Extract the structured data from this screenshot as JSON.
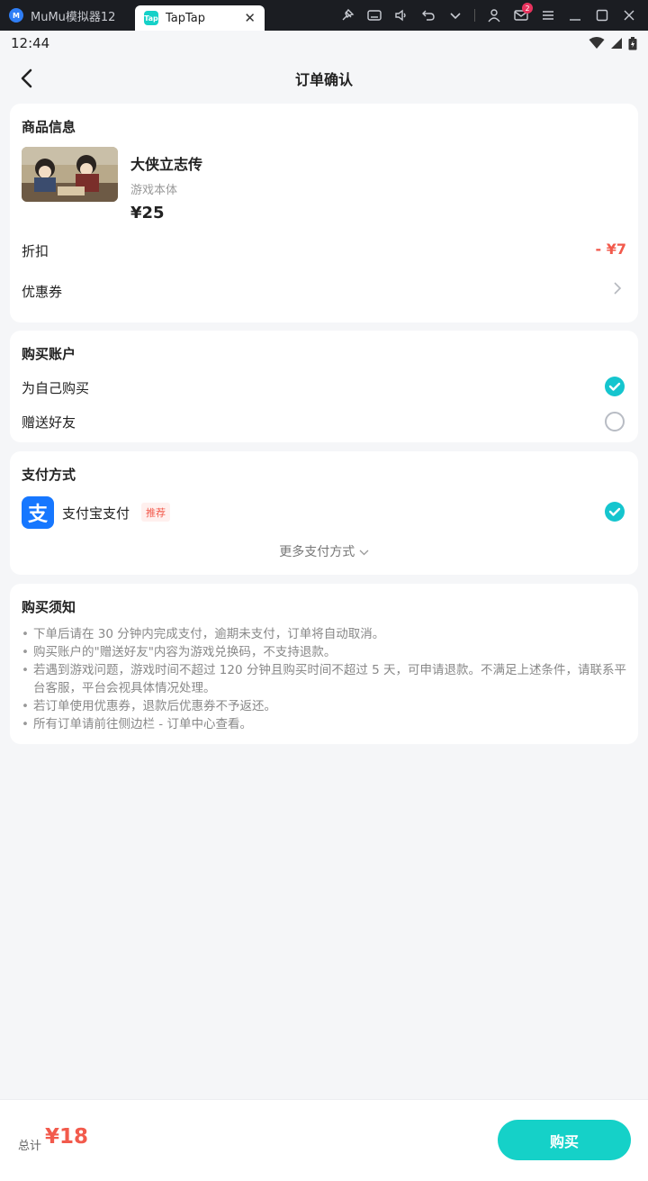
{
  "emulator": {
    "tabs": [
      {
        "label": "MuMu模拟器12"
      },
      {
        "label": "TapTap"
      }
    ],
    "mail_badge": "2"
  },
  "status_bar": {
    "time": "12:44"
  },
  "header": {
    "title": "订单确认"
  },
  "product_section": {
    "title": "商品信息",
    "name": "大侠立志传",
    "type": "游戏本体",
    "price": "¥25",
    "discount_label": "折扣",
    "discount_value": "- ¥7",
    "coupon_label": "优惠券"
  },
  "account_section": {
    "title": "购买账户",
    "options": [
      {
        "label": "为自己购买",
        "selected": true
      },
      {
        "label": "赠送好友",
        "selected": false
      }
    ]
  },
  "payment_section": {
    "title": "支付方式",
    "method_icon_text": "支",
    "method": "支付宝支付",
    "recommend_tag": "推荐",
    "selected": true,
    "more_label": "更多支付方式"
  },
  "notice_section": {
    "title": "购买须知",
    "items": [
      "下单后请在 30 分钟内完成支付，逾期未支付，订单将自动取消。",
      "购买账户的\"赠送好友\"内容为游戏兑换码，不支持退款。",
      "若遇到游戏问题，游戏时间不超过 120 分钟且购买时间不超过 5 天，可申请退款。不满足上述条件，请联系平台客服，平台会视具体情况处理。",
      "若订单使用优惠券，退款后优惠券不予返还。",
      "所有订单请前往侧边栏 - 订单中心查看。"
    ]
  },
  "bottom_bar": {
    "total_label": "总计",
    "total_amount": "¥18",
    "buy_label": "购买"
  },
  "colors": {
    "accent": "#15d1c8",
    "price_red": "#f25a4c",
    "alipay_blue": "#1677ff"
  }
}
